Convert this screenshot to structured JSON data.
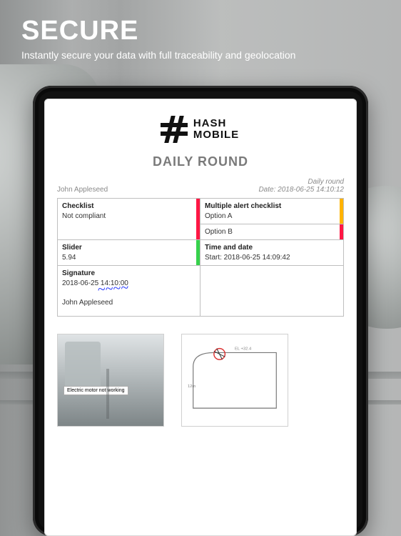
{
  "hero": {
    "title": "SECURE",
    "subtitle": "Instantly secure your data with full traceability and geolocation"
  },
  "brand": {
    "line1": "HASH",
    "line2": "MOBILE"
  },
  "document": {
    "title": "DAILY ROUND",
    "author": "John Appleseed",
    "type_label": "Daily round",
    "date_prefix": "Date: ",
    "date": "2018-06-25 14:10:12"
  },
  "cells": {
    "checklist": {
      "label": "Checklist",
      "value": "Not compliant"
    },
    "multi": {
      "label": "Multiple alert checklist",
      "opt_a": "Option A",
      "opt_b": "Option B"
    },
    "slider": {
      "label": "Slider",
      "value": "5.94"
    },
    "timedate": {
      "label": "Time and date",
      "value": "Start: 2018-06-25 14:09:42"
    },
    "signature": {
      "label": "Signature",
      "ts": "2018-06-25 14:10:00",
      "name": "John Appleseed"
    }
  },
  "photo_caption": "Electric motor not working"
}
